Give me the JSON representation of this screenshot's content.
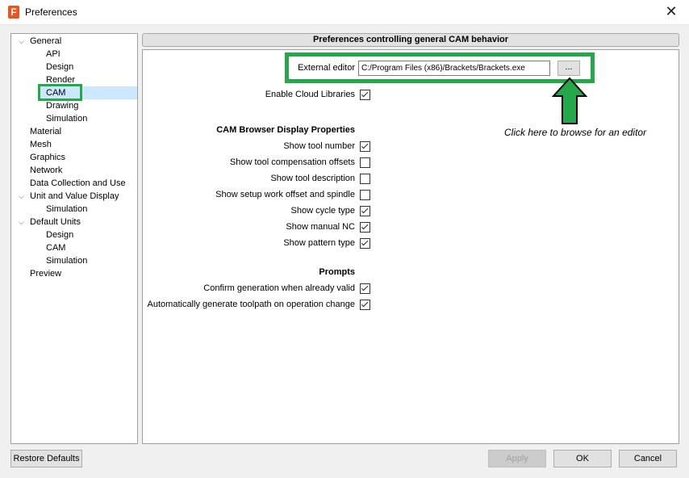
{
  "window": {
    "title": "Preferences",
    "close_glyph": "✕",
    "icon": "autodesk-fusion-icon"
  },
  "tree": [
    {
      "label": "General",
      "expanded": true
    },
    {
      "label": "API"
    },
    {
      "label": "Design"
    },
    {
      "label": "Render"
    },
    {
      "label": "CAM",
      "selected": true
    },
    {
      "label": "Drawing"
    },
    {
      "label": "Simulation"
    },
    {
      "label": "Material"
    },
    {
      "label": "Mesh"
    },
    {
      "label": "Graphics"
    },
    {
      "label": "Network"
    },
    {
      "label": "Data Collection and Use"
    },
    {
      "label": "Unit and Value Display",
      "expanded": true
    },
    {
      "label": "Simulation"
    },
    {
      "label": "Default Units",
      "expanded": true
    },
    {
      "label": "Design"
    },
    {
      "label": "CAM"
    },
    {
      "label": "Simulation"
    },
    {
      "label": "Preview"
    }
  ],
  "panel": {
    "header": "Preferences controlling general CAM behavior",
    "external_editor_label": "External editor",
    "external_editor_value": "C:/Program Files (x86)/Brackets/Brackets.exe",
    "browse_label": "...",
    "enable_cloud_label": "Enable Cloud Libraries",
    "enable_cloud_checked": true,
    "hint": "Click here to browse for an editor",
    "browser_section": "CAM Browser Display Properties",
    "browser_options": [
      {
        "label": "Show tool number",
        "checked": true
      },
      {
        "label": "Show tool compensation offsets",
        "checked": false
      },
      {
        "label": "Show tool description",
        "checked": false
      },
      {
        "label": "Show setup work offset and spindle",
        "checked": false
      },
      {
        "label": "Show cycle type",
        "checked": true
      },
      {
        "label": "Show manual NC",
        "checked": true
      },
      {
        "label": "Show pattern type",
        "checked": true
      }
    ],
    "prompts_section": "Prompts",
    "prompt_options": [
      {
        "label": "Confirm generation when already valid",
        "checked": true
      },
      {
        "label": "Automatically generate toolpath on operation change",
        "checked": true
      }
    ]
  },
  "buttons": {
    "restore": "Restore Defaults",
    "apply": "Apply",
    "ok": "OK",
    "cancel": "Cancel"
  },
  "colors": {
    "highlight": "#25a84a",
    "selection": "#cce8ff"
  }
}
